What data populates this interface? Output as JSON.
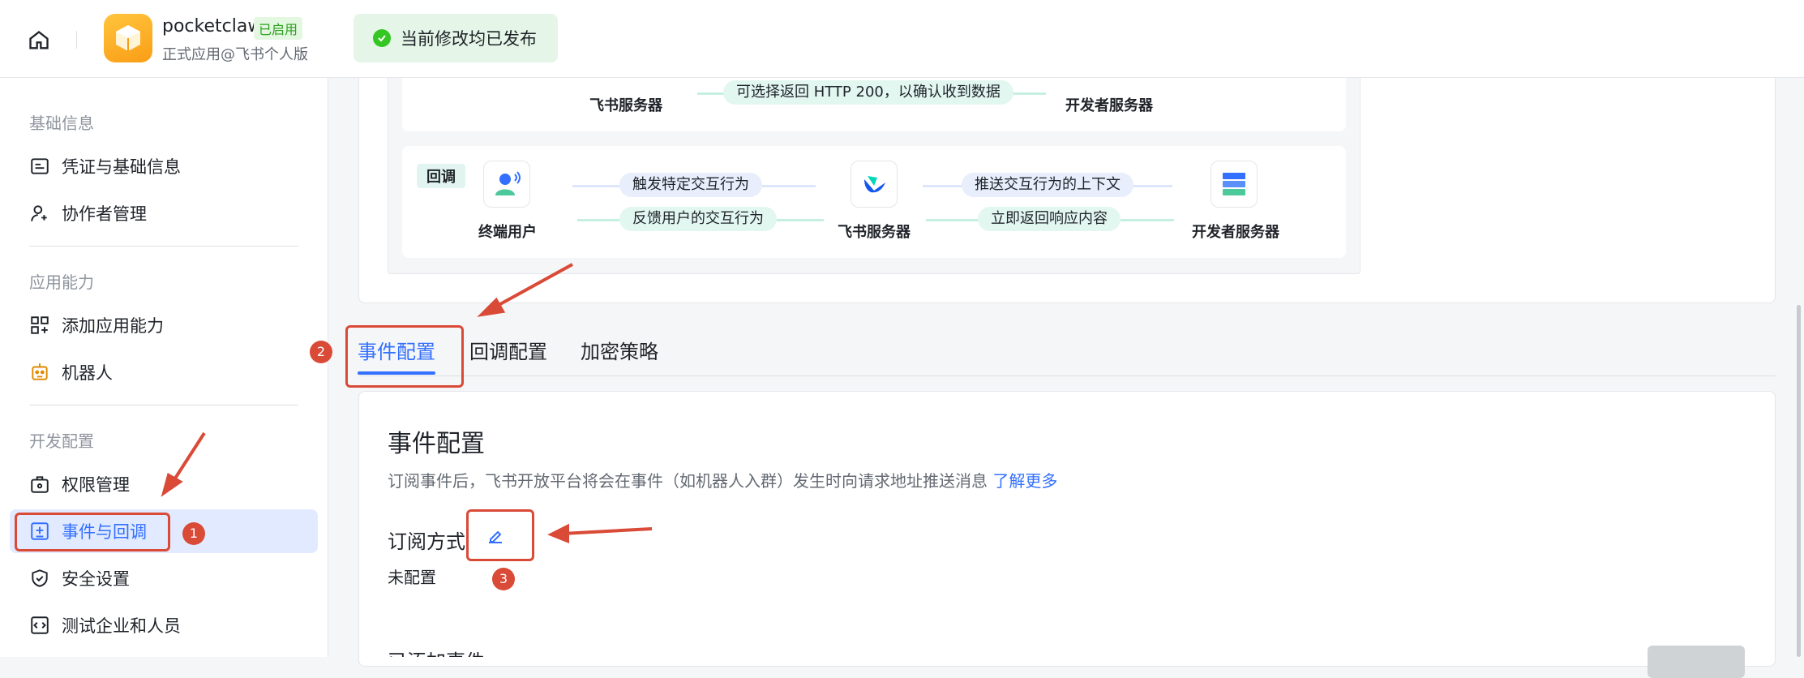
{
  "topbar": {
    "app_name": "pocketclaw",
    "app_status": "已启用",
    "app_subtitle": "正式应用@飞书个人版",
    "toast": "当前修改均已发布"
  },
  "sidebar": {
    "sections": [
      {
        "title": "基础信息",
        "items": [
          {
            "label": "凭证与基础信息",
            "icon": "credential-icon"
          },
          {
            "label": "协作者管理",
            "icon": "user-add-icon"
          }
        ]
      },
      {
        "title": "应用能力",
        "items": [
          {
            "label": "添加应用能力",
            "icon": "apps-add-icon"
          },
          {
            "label": "机器人",
            "icon": "robot-icon"
          }
        ]
      },
      {
        "title": "开发配置",
        "items": [
          {
            "label": "权限管理",
            "icon": "permission-icon"
          },
          {
            "label": "事件与回调",
            "icon": "event-icon",
            "active": true
          },
          {
            "label": "安全设置",
            "icon": "shield-icon"
          },
          {
            "label": "测试企业和人员",
            "icon": "code-icon"
          }
        ]
      }
    ]
  },
  "flow": {
    "row1": {
      "left_label": "飞书服务器",
      "pill": "可选择返回 HTTP 200，以确认收到数据",
      "right_label": "开发者服务器"
    },
    "row2": {
      "tag": "回调",
      "node1": "终端用户",
      "node2": "飞书服务器",
      "node3": "开发者服务器",
      "pill_top_left": "触发特定交互行为",
      "pill_bottom_left": "反馈用户的交互行为",
      "pill_top_right": "推送交互行为的上下文",
      "pill_bottom_right": "立即返回响应内容"
    }
  },
  "tabs": [
    {
      "label": "事件配置",
      "active": true
    },
    {
      "label": "回调配置"
    },
    {
      "label": "加密策略"
    }
  ],
  "main": {
    "title": "事件配置",
    "desc": "订阅事件后，飞书开放平台将会在事件（如机器人入群）发生时向请求地址推送消息",
    "link": "了解更多",
    "subscribe_label": "订阅方式",
    "subscribe_value": "未配置",
    "added_events": "已添加事件"
  },
  "annotations": {
    "n1": "1",
    "n2": "2",
    "n3": "3"
  },
  "colors": {
    "accent": "#3370ff",
    "annotation": "#d94a37",
    "success": "#34c724"
  }
}
